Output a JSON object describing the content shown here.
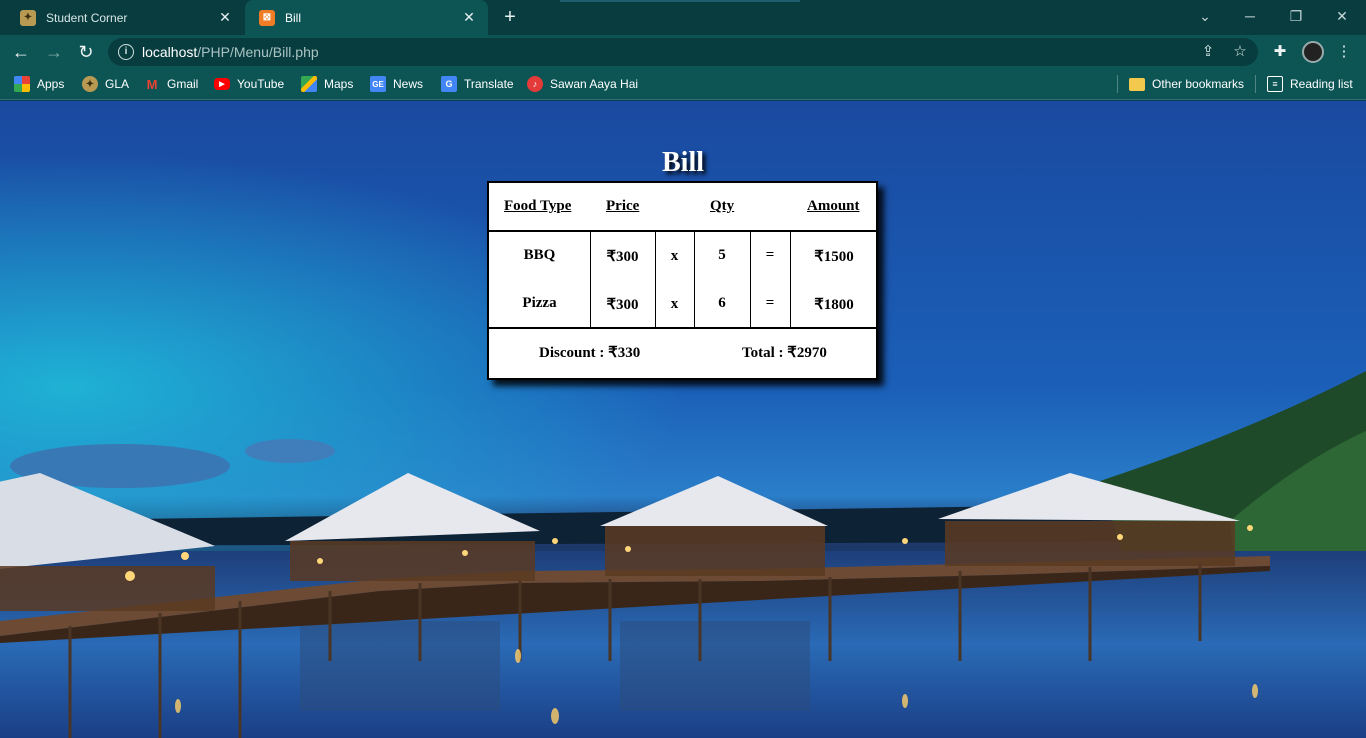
{
  "tabs": [
    {
      "title": "Student Corner",
      "active": false
    },
    {
      "title": "Bill",
      "active": true
    }
  ],
  "address_bar": {
    "host": "localhost",
    "path": "/PHP/Menu/Bill.php"
  },
  "bookmarks": [
    "Apps",
    "GLA",
    "Gmail",
    "YouTube",
    "Maps",
    "News",
    "Translate",
    "Sawan Aaya Hai"
  ],
  "bookmarks_right": {
    "other": "Other bookmarks",
    "reading": "Reading list"
  },
  "page": {
    "title": "Bill",
    "headers": {
      "food_type": "Food Type",
      "price": "Price",
      "qty": "Qty",
      "amount": "Amount"
    },
    "rows": [
      {
        "food": "BBQ",
        "price": "₹300",
        "times": "x",
        "qty": "5",
        "equals": "=",
        "amount": "₹1500"
      },
      {
        "food": "Pizza",
        "price": "₹300",
        "times": "x",
        "qty": "6",
        "equals": "=",
        "amount": "₹1800"
      }
    ],
    "discount": "Discount : ₹330",
    "total": "Total : ₹2970"
  },
  "colors": {
    "chrome_dark": "#093c3f",
    "chrome": "#0d5555",
    "accent": "#f07c25"
  }
}
